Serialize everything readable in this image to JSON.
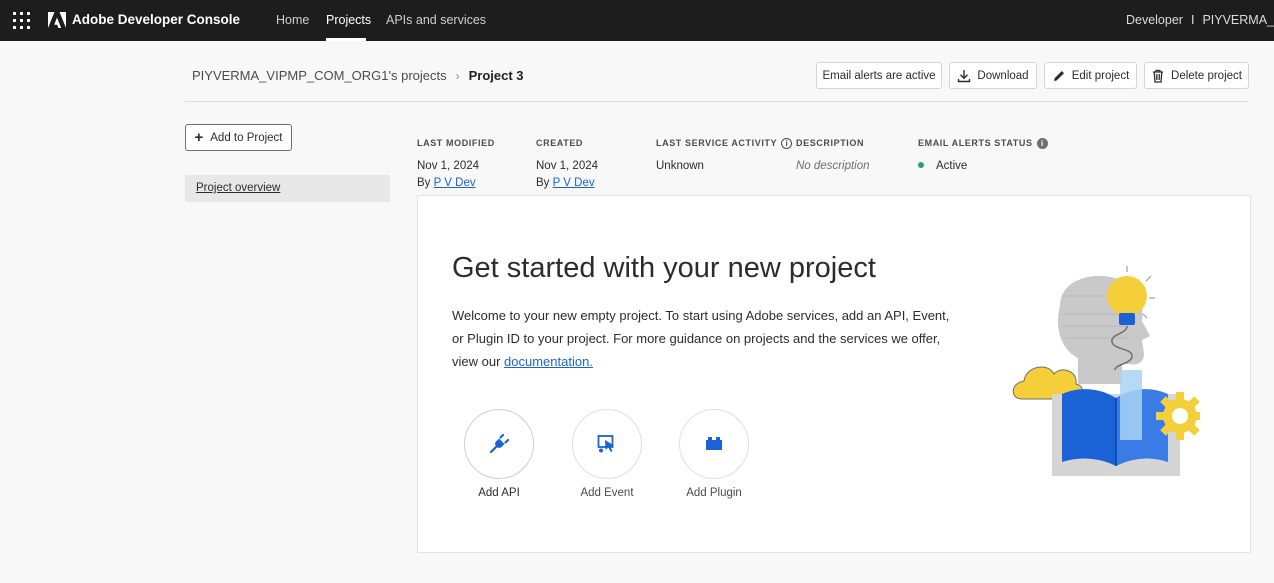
{
  "topbar": {
    "app_title": "Adobe Developer Console",
    "nav": [
      "Home",
      "Projects",
      "APIs and services"
    ],
    "active_nav": "Projects",
    "role": "Developer",
    "separator": "I",
    "org": "PIYVERMA_"
  },
  "breadcrumb": {
    "parent": "PIYVERMA_VIPMP_COM_ORG1's projects",
    "current": "Project 3"
  },
  "header_buttons": {
    "email_alerts": "Email alerts are active",
    "download": "Download",
    "edit": "Edit project",
    "delete": "Delete project"
  },
  "sidebar": {
    "add_button": "Add to Project",
    "items": [
      "Project overview"
    ]
  },
  "meta": {
    "last_modified": {
      "label": "LAST MODIFIED",
      "date": "Nov 1, 2024",
      "by_prefix": "By",
      "by": "P V Dev"
    },
    "created": {
      "label": "CREATED",
      "date": "Nov 1, 2024",
      "by_prefix": "By",
      "by": "P V Dev"
    },
    "last_service_activity": {
      "label": "LAST SERVICE ACTIVITY",
      "value": "Unknown"
    },
    "description": {
      "label": "DESCRIPTION",
      "value": "No description"
    },
    "email_alerts_status": {
      "label": "EMAIL ALERTS STATUS",
      "value": "Active"
    }
  },
  "card": {
    "title": "Get started with your new project",
    "desc_text": "Welcome to your new empty project. To start using Adobe services, add an API, Event, or Plugin ID to your project. For more guidance on projects and the services we offer, view our ",
    "doc_link": "documentation.",
    "actions": [
      "Add API",
      "Add Event",
      "Add Plugin"
    ]
  },
  "colors": {
    "topbar_bg": "#1d1d1d",
    "accent_blue": "#1a62d6",
    "status_green": "#2d9d78",
    "illustration_yellow": "#f4cf3a"
  },
  "icons": [
    "app-switcher-icon",
    "adobe-logo-icon",
    "chevron-right-icon",
    "download-icon",
    "pencil-icon",
    "trash-icon",
    "plus-icon",
    "info-icon",
    "plug-icon",
    "event-icon",
    "plugin-icon"
  ]
}
